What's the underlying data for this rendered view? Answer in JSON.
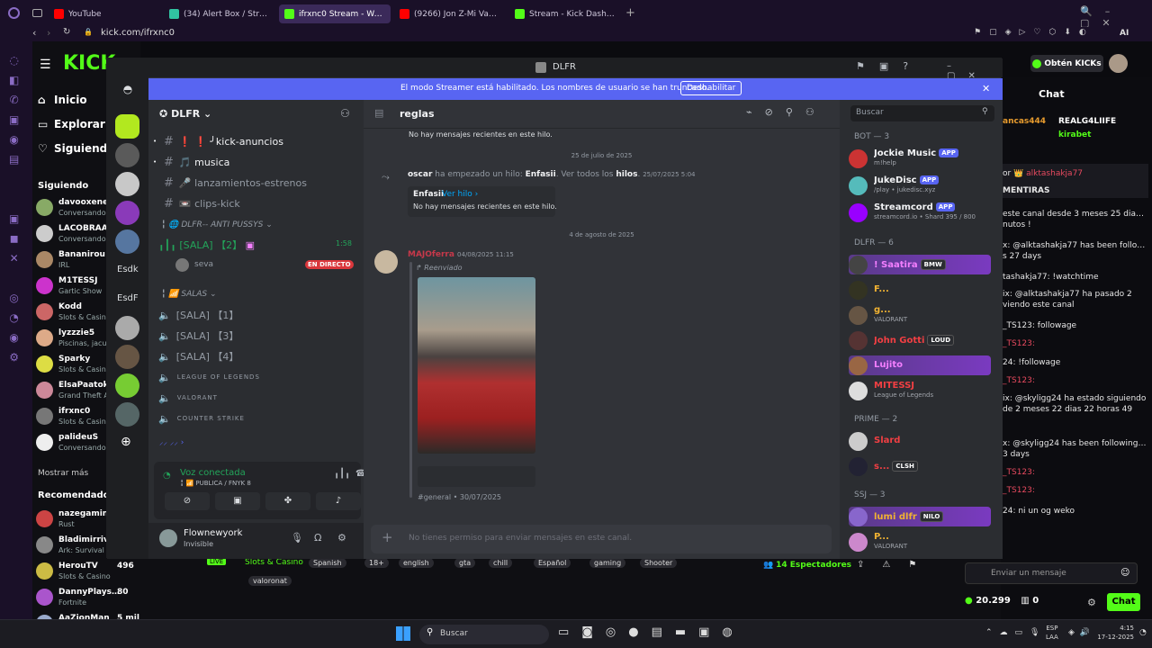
{
  "browser": {
    "tabs": [
      {
        "title": "YouTube",
        "color": "#ff0000"
      },
      {
        "title": "(34) Alert Box / Streamlabs",
        "color": "#31c3a2"
      },
      {
        "title": "ifrxnc0 Stream - Watch",
        "color": "#53fc18",
        "active": true
      },
      {
        "title": "(9266) Jon Z-Mi Vaso Bla",
        "color": "#ff0000"
      },
      {
        "title": "Stream - Kick Dashboard",
        "color": "#53fc18"
      }
    ],
    "url": "kick.com/ifrxnc0",
    "ai": "AI"
  },
  "kick": {
    "logo": "KICK",
    "nav": [
      {
        "label": "Inicio",
        "icon": "⌂"
      },
      {
        "label": "Explorar",
        "icon": "▭"
      },
      {
        "label": "Siguiendo",
        "icon": "♡"
      }
    ],
    "following_title": "Siguiendo",
    "following": [
      {
        "name": "davooxeneize",
        "game": "Conversando",
        "color": "#8a6"
      },
      {
        "name": "LACOBRAAA",
        "game": "Conversando",
        "color": "#ccc"
      },
      {
        "name": "Bananirou",
        "game": "IRL",
        "color": "#a86"
      },
      {
        "name": "M1TESSJ",
        "game": "Gartic Show",
        "color": "#c3c"
      },
      {
        "name": "Kodd",
        "game": "Slots & Casino",
        "color": "#c66"
      },
      {
        "name": "lyzzzie5",
        "game": "Piscinas, jacuzzis",
        "color": "#da8"
      },
      {
        "name": "Sparky",
        "game": "Slots & Casino",
        "color": "#dd4"
      },
      {
        "name": "ElsaPaatok",
        "game": "Grand Theft Auto",
        "color": "#c89"
      },
      {
        "name": "ifrxnc0",
        "game": "Slots & Casino",
        "color": "#777"
      },
      {
        "name": "palideuS",
        "game": "Conversando",
        "color": "#eee"
      }
    ],
    "show_more": "Mostrar más",
    "recommended_title": "Recomendado",
    "recommended": [
      {
        "name": "nazegaming",
        "game": "Rust",
        "viewers": "",
        "color": "#c44"
      },
      {
        "name": "Bladimirriva",
        "game": "Ark: Survival",
        "viewers": "",
        "color": "#888"
      },
      {
        "name": "HerouTV",
        "game": "Slots & Casino",
        "viewers": "496",
        "color": "#cb4"
      },
      {
        "name": "DannyPlaysRD",
        "game": "Fortnite",
        "viewers": "80",
        "color": "#a5c"
      },
      {
        "name": "AaZionMan",
        "game": "",
        "viewers": "5 mil",
        "color": "#9ac"
      }
    ],
    "obtain": "Obtén KICKs",
    "chat_title": "Chat",
    "pinned": [
      {
        "name": "ancas444",
        "c": "#e89c2e"
      },
      {
        "name": "REALG4LIIFE",
        "c": "#fff"
      },
      {
        "name": "kirabet",
        "c": "#53fc18"
      }
    ],
    "pinned_msg": "MENTIRAS",
    "pinned_prefix": "or",
    "pinned_user": "alktashakja77",
    "chat": [
      {
        "t": "este canal desde 3 meses 25 dias 3",
        "c": "#e6e6e6"
      },
      {
        "t": "nutos !",
        "c": "#e6e6e6"
      },
      {
        "t": "x: @alktashakja77 has been following",
        "c": "#e6e6e6"
      },
      {
        "t": "s 27 days",
        "c": "#e6e6e6"
      },
      {
        "t": "tashakja77: !watchtime",
        "c": "#e6e6e6"
      },
      {
        "t": "ix: @alktashakja77 ha pasado 2",
        "c": "#e6e6e6"
      },
      {
        "t": "viendo este canal",
        "c": "#e6e6e6"
      },
      {
        "t": "_TS123: followage",
        "c": "#e6e6e6"
      },
      {
        "t": "_TS123:",
        "c": "#e84a5f"
      },
      {
        "t": "24: !followage",
        "c": "#e6e6e6"
      },
      {
        "t": "_TS123:",
        "c": "#e84a5f"
      },
      {
        "t": "ix: @skyligg24 ha estado siguiendo",
        "c": "#e6e6e6"
      },
      {
        "t": "de 2 meses 22 dias 22 horas 49",
        "c": "#e6e6e6"
      },
      {
        "t": "x: @skyligg24 has been following for",
        "c": "#e6e6e6"
      },
      {
        "t": "3 days",
        "c": "#e6e6e6"
      },
      {
        "t": "_TS123:",
        "c": "#e84a5f"
      },
      {
        "t": "_TS123:",
        "c": "#e84a5f"
      },
      {
        "t": "24: ni un og weko",
        "c": "#e6e6e6"
      }
    ],
    "chat_placeholder": "Enviar un mensaje",
    "points": "20.299",
    "kicks": "0",
    "chat_btn": "Chat",
    "live": "LIVE",
    "category": "Slots & Casino",
    "tags": [
      "Spanish",
      "18+",
      "english",
      "gta",
      "chill",
      "Español",
      "gaming",
      "Shooter",
      "valoronat"
    ],
    "viewers": "14 Espectadores"
  },
  "discord": {
    "title": "DLFR",
    "banner_text": "El modo Streamer está habilitado. Los nombres de usuario se han truncado.",
    "banner_btn": "Deshabilitar",
    "server": "DLFR",
    "guild_labels": [
      "Esdk",
      "EsdF"
    ],
    "channels": [
      {
        "icon": "#",
        "name": "❗ ❗ ╯kick-anuncios",
        "color": "#f2f3f5"
      },
      {
        "icon": "#",
        "name": "🎵 musica",
        "color": "#f2f3f5"
      },
      {
        "icon": "#",
        "name": "🎤 lanzamientos-estrenos",
        "color": "#949ba4"
      },
      {
        "icon": "#",
        "name": "📼 clips-kick",
        "color": "#949ba4"
      }
    ],
    "cat1": "DLFR-- ANTI PUSSYS",
    "voice_active": {
      "name": "[SALA] 【2】",
      "time": "1:58",
      "user": "seva",
      "live": "EN DIRECTO"
    },
    "cat2": "SALAS",
    "voice": [
      {
        "name": "[SALA] 【1】"
      },
      {
        "name": "[SALA] 【3】"
      },
      {
        "name": "[SALA] 【4】"
      },
      {
        "name": "LEAGUE OF LEGENDS"
      },
      {
        "name": "VALORANT"
      },
      {
        "name": "COUNTER STRIKE"
      }
    ],
    "voice_status": "Voz conectada",
    "voice_sub": "PUBLICA / FNYK 8",
    "user": {
      "name": "Flownewyork",
      "status": "Invisible"
    },
    "channel": "reglas",
    "search": "Buscar",
    "feed": {
      "no_msgs": "No hay mensajes recientes en este hilo.",
      "date1": "25 de julio de 2025",
      "thread_user": "oscar",
      "thread_mid": "ha empezado un hilo:",
      "thread_name": "Enfasii",
      "thread_tail": ". Ver todos los",
      "thread_hilos": "hilos",
      "thread_time": "25/07/2025 5:04",
      "thread_card": "Enfasii",
      "ver_hilo": "Ver hilo ›",
      "date2": "4 de agosto de 2025",
      "msg_user": "MAJOferra",
      "msg_time": "04/08/2025 11:15",
      "forwarded": "Reenviado",
      "footer": "#general • 30/07/2025"
    },
    "composer": "No tienes permiso para enviar mensajes en este canal.",
    "groups": [
      {
        "title": "BOT — 3",
        "members": [
          {
            "name": "Jockie Music",
            "badge": "APP",
            "sub": "m!help",
            "c": "#f2f3f5",
            "av": "#c33"
          },
          {
            "name": "JukeDisc",
            "badge": "APP",
            "sub": "/play • jukedisc.xyz",
            "c": "#f2f3f5",
            "av": "#5bb"
          },
          {
            "name": "Streamcord",
            "badge": "APP",
            "sub": "streamcord.io • Shard 395 / 800",
            "c": "#f2f3f5",
            "av": "#90f"
          }
        ]
      },
      {
        "title": "DLFR — 6",
        "members": [
          {
            "name": "! Saatira",
            "badge": "BMW",
            "sub": "",
            "c": "#f47fff",
            "av": "#444",
            "hl": true
          },
          {
            "name": "F...",
            "badge": "",
            "sub": "",
            "c": "#f0b232",
            "av": "#332"
          },
          {
            "name": "g...",
            "badge": "",
            "sub": "VALORANT",
            "c": "#f0b232",
            "av": "#654"
          },
          {
            "name": "John Gotti",
            "badge": "LOUD",
            "sub": "",
            "c": "#f23f43",
            "av": "#533"
          },
          {
            "name": "Lujito",
            "badge": "",
            "sub": "",
            "c": "#f47fff",
            "av": "#964",
            "hl": true
          },
          {
            "name": "MITESSJ",
            "badge": "",
            "sub": "League of Legends",
            "c": "#f23f43",
            "av": "#ddd"
          }
        ]
      },
      {
        "title": "PRIME — 2",
        "members": [
          {
            "name": "Slard",
            "badge": "",
            "sub": "",
            "c": "#f23f43",
            "av": "#ccc"
          },
          {
            "name": "s...",
            "badge": "CLSH",
            "sub": "",
            "c": "#f23f43",
            "av": "#223"
          }
        ]
      },
      {
        "title": "SSJ — 3",
        "members": [
          {
            "name": "lumi dlfr",
            "badge": "NILO",
            "sub": "",
            "c": "#f0b232",
            "av": "#86c",
            "hl": true
          },
          {
            "name": "P...",
            "badge": "",
            "sub": "VALORANT",
            "c": "#f0b232",
            "av": "#c8c"
          }
        ]
      }
    ]
  },
  "taskbar": {
    "search": "Buscar",
    "lang1": "ESP",
    "lang2": "LAA",
    "time": "4:15",
    "date": "17-12-2025"
  }
}
